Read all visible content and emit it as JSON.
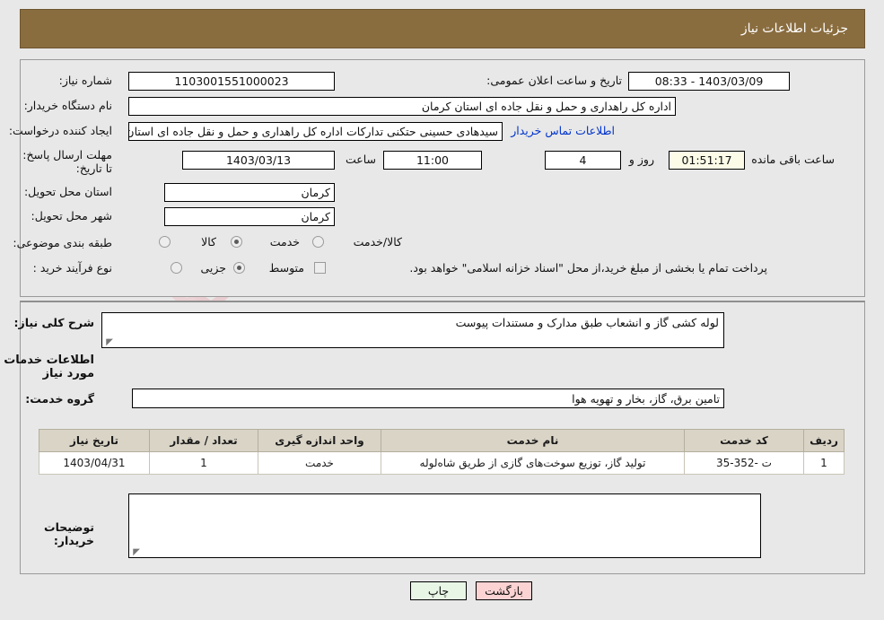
{
  "header": {
    "title": "جزئیات اطلاعات نیاز"
  },
  "fields": {
    "need_number": {
      "label": "شماره نیاز:",
      "value": "1103001551000023"
    },
    "announce_datetime": {
      "label": "تاریخ و ساعت اعلان عمومی:",
      "value": "1403/03/09 - 08:33"
    },
    "buyer_org": {
      "label": "نام دستگاه خریدار:",
      "value": "اداره کل راهداری و حمل و نقل جاده ای استان کرمان"
    },
    "requester": {
      "label": "ایجاد کننده درخواست:",
      "value": "سیدهادی حسینی حتکنی تدارکات اداره کل راهداری و حمل و نقل جاده ای استان کرمان"
    },
    "buyer_contact_link": "اطلاعات تماس خریدار",
    "deadline": {
      "label": "مهلت ارسال پاسخ: تا تاریخ:",
      "date": "1403/03/13"
    },
    "deadline_time": {
      "label": "ساعت",
      "value": "11:00"
    },
    "remaining_days": {
      "value": "4",
      "label": "روز و"
    },
    "remaining_time": {
      "value": "01:51:17",
      "label": "ساعت باقی مانده"
    },
    "delivery_province": {
      "label": "استان محل تحویل:",
      "value": "کرمان"
    },
    "delivery_city": {
      "label": "شهر محل تحویل:",
      "value": "کرمان"
    },
    "category": {
      "label": "طبقه بندی موضوعی:",
      "options": [
        {
          "label": "کالا",
          "selected": false
        },
        {
          "label": "خدمت",
          "selected": true
        },
        {
          "label": "کالا/خدمت",
          "selected": false
        }
      ]
    },
    "purchase_process": {
      "label": "نوع فرآیند خرید :",
      "options": [
        {
          "label": "جزیی",
          "selected": false
        },
        {
          "label": "متوسط",
          "selected": true
        }
      ],
      "checkbox_label": "پرداخت تمام یا بخشی از مبلغ خرید،از محل \"اسناد خزانه اسلامی\" خواهد بود.",
      "checkbox_checked": false
    },
    "general_description": {
      "label": "شرح کلی نیاز:",
      "value": "لوله کشی گاز و انشعاب طبق مدارک و مستندات پیوست"
    },
    "services_section_title": "اطلاعات خدمات مورد نیاز",
    "service_group": {
      "label": "گروه خدمت:",
      "value": "تامین برق، گاز، بخار و تهویه هوا"
    },
    "buyer_notes": {
      "label": "توضیحات خریدار:",
      "value": ""
    }
  },
  "table": {
    "columns": [
      "ردیف",
      "کد خدمت",
      "نام خدمت",
      "واحد اندازه گیری",
      "تعداد / مقدار",
      "تاریخ نیاز"
    ],
    "rows": [
      {
        "row": "1",
        "service_code": "ت -352-35",
        "service_name": "تولید گاز، توزیع سوخت‌های گازی از طریق شاه‌لوله",
        "unit": "خدمت",
        "quantity": "1",
        "need_date": "1403/04/31"
      }
    ]
  },
  "footer": {
    "print_label": "چاپ",
    "back_label": "بازگشت"
  },
  "colors": {
    "header_bar": "#8a6d3f",
    "link": "#0033cc",
    "table_header": "#d9d4c6",
    "print_button": "#e8f6e6",
    "back_button": "#fbd3d3",
    "countdown_field": "#fbfbe8"
  },
  "watermark": {
    "text": "AriaTender.net"
  }
}
